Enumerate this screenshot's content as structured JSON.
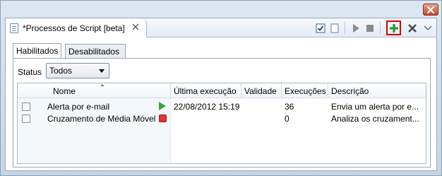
{
  "view": {
    "title": "*Processos de Script [beta]",
    "toolbar": {
      "checkbox_icon": "checkbox-checked-icon",
      "uncheck_icon": "checkbox-empty-icon",
      "run_icon": "play-icon",
      "stop_icon": "stop-icon",
      "add_icon": "add-icon",
      "delete_icon": "delete-icon",
      "menu_icon": "view-menu-icon"
    }
  },
  "tabs": [
    {
      "label": "Habilitados",
      "active": true
    },
    {
      "label": "Desabilitados",
      "active": false
    }
  ],
  "filter": {
    "label": "Status",
    "selected": "Todos"
  },
  "table": {
    "columns": [
      "Nome",
      "Última execução",
      "Validade",
      "Execuções",
      "Descrição"
    ],
    "rows": [
      {
        "checked": false,
        "name": "Alerta por e-mail",
        "state": "running",
        "last_run": "22/08/2012 15:19",
        "validity": "",
        "executions": "36",
        "description": "Envia um alerta por e..."
      },
      {
        "checked": false,
        "name": "Cruzamento de Média Móvel",
        "state": "stopped",
        "last_run": "",
        "validity": "",
        "executions": "0",
        "description": "Analiza os cruzament..."
      }
    ]
  },
  "colors": {
    "accent_green": "#3aa33a",
    "stop_red": "#e0343a",
    "highlight_border": "#d40000"
  }
}
